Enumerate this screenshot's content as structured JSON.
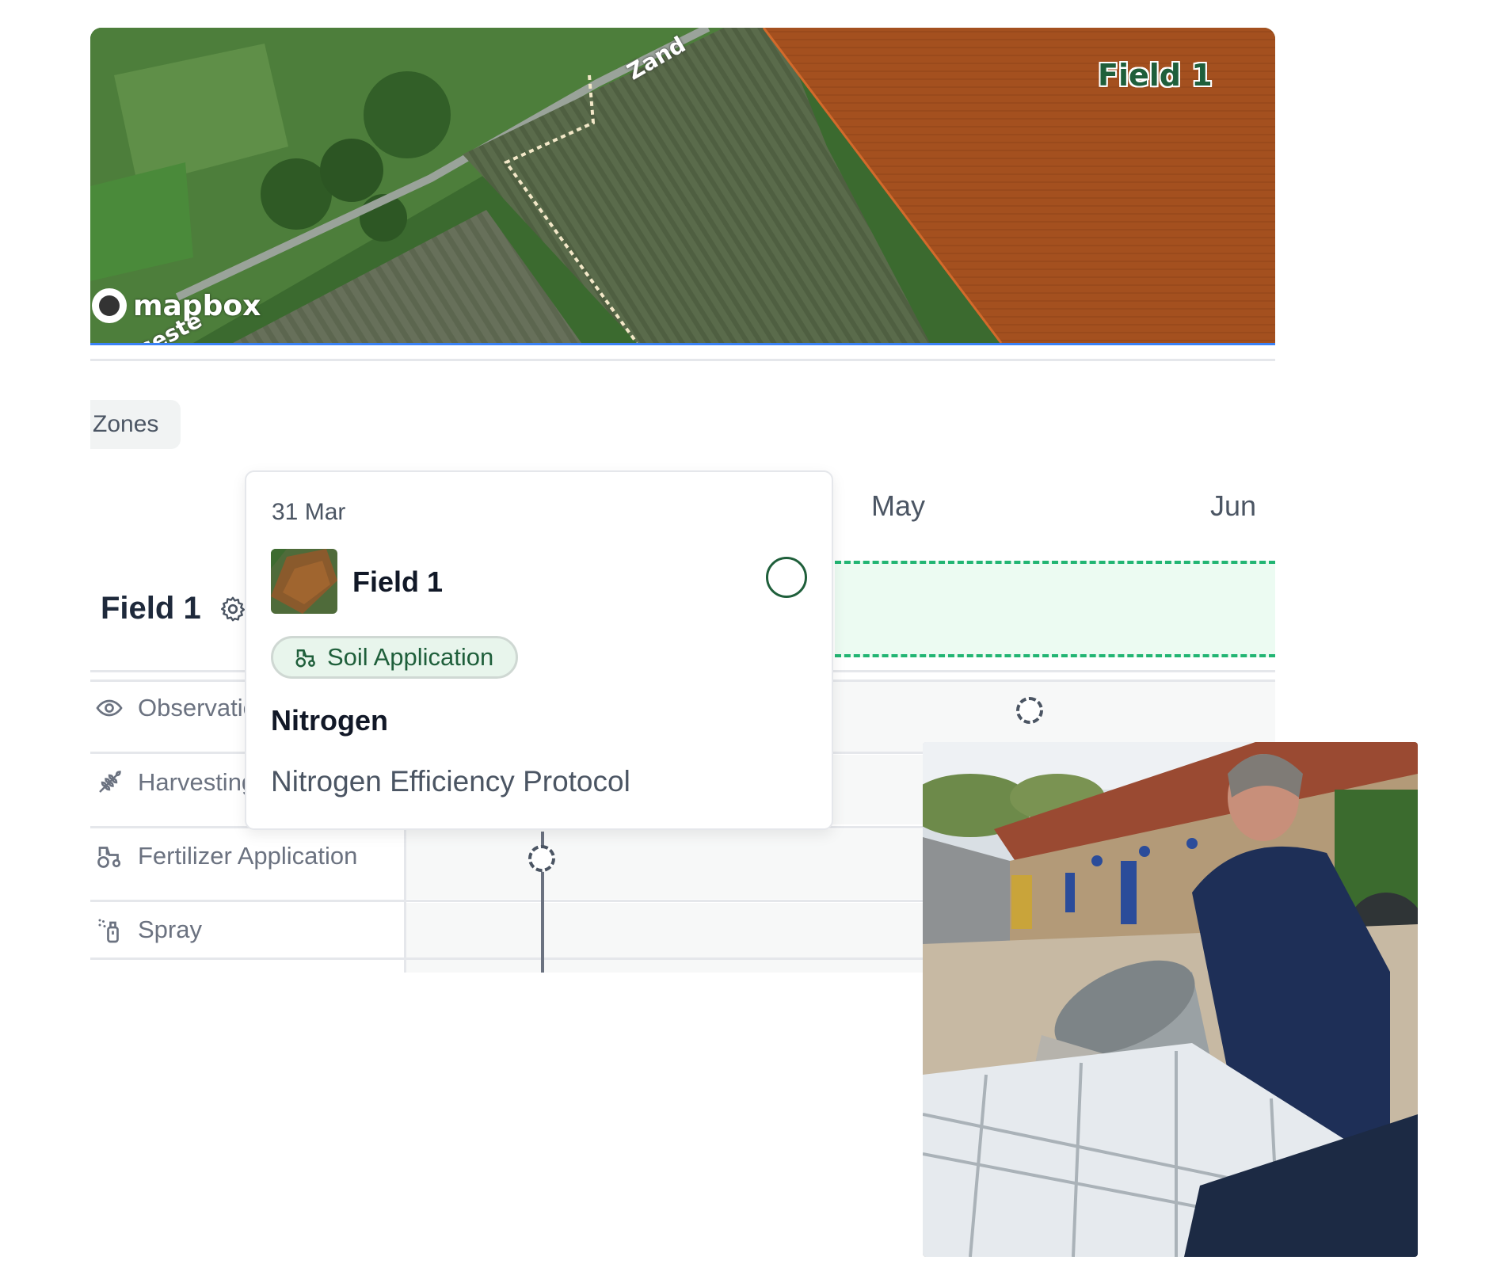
{
  "map": {
    "field_label": "Field 1",
    "attribution": "mapbox",
    "road_label_1": "Zand",
    "road_label_2": "nseste",
    "colors": {
      "field_fill": "#a4501f",
      "crop_green": "#3f6e34",
      "outline": "#3b82f6"
    }
  },
  "zones": {
    "label": "Zones"
  },
  "timeline": {
    "months": [
      "May",
      "Jun"
    ],
    "field_title": "Field 1",
    "rows": [
      {
        "icon": "eye-icon",
        "label": "Observations"
      },
      {
        "icon": "wheat-icon",
        "label": "Harvesting"
      },
      {
        "icon": "tractor-icon",
        "label": "Fertilizer Application"
      },
      {
        "icon": "spray-bottle-icon",
        "label": "Spray"
      }
    ],
    "band_color": "#22b573"
  },
  "popover": {
    "date": "31 Mar",
    "field_name": "Field 1",
    "badge": "Soil Application",
    "nutrient": "Nitrogen",
    "protocol": "Nitrogen Efficiency Protocol"
  }
}
